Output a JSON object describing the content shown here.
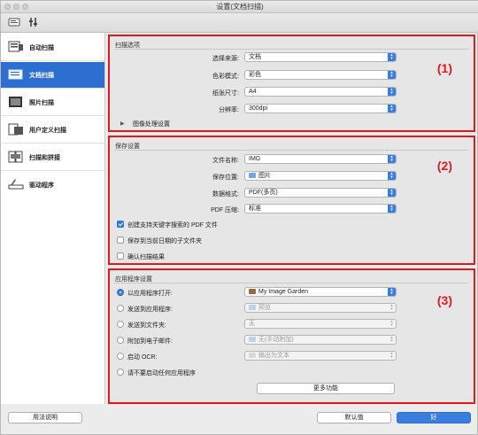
{
  "window": {
    "title": "设置(文档扫描)"
  },
  "toolbar": {
    "tab1_icon": "scanner-settings-icon",
    "tab2_icon": "general-settings-icon"
  },
  "sidebar": {
    "items": [
      {
        "label": "自动扫描",
        "icon": "auto-scan-icon"
      },
      {
        "label": "文档扫描",
        "icon": "document-scan-icon"
      },
      {
        "label": "照片扫描",
        "icon": "photo-scan-icon"
      },
      {
        "label": "用户定义扫描",
        "icon": "custom-scan-icon"
      },
      {
        "label": "扫描和拼接",
        "icon": "scan-stitch-icon"
      },
      {
        "label": "驱动程序",
        "icon": "driver-icon"
      }
    ],
    "selected_index": 1
  },
  "scan_options": {
    "title": "扫描选项",
    "marker": "(1)",
    "rows": [
      {
        "label": "选择来源:",
        "value": "文档"
      },
      {
        "label": "色彩模式:",
        "value": "彩色"
      },
      {
        "label": "纸张尺寸:",
        "value": "A4"
      },
      {
        "label": "分辨率:",
        "value": "300dpi"
      }
    ],
    "image_processing": "图像处理设置"
  },
  "save_settings": {
    "title": "保存设置",
    "marker": "(2)",
    "rows": [
      {
        "label": "文件名称:",
        "value": "IMG"
      },
      {
        "label": "保存位置:",
        "value": "图片"
      },
      {
        "label": "数据格式:",
        "value": "PDF(多页)"
      },
      {
        "label": "PDF 压缩:",
        "value": "标准"
      }
    ],
    "checks": [
      {
        "label": "创建支持关键字搜索的 PDF 文件",
        "checked": true
      },
      {
        "label": "保存到当前日期的子文件夹",
        "checked": false
      },
      {
        "label": "确认扫描结果",
        "checked": false
      }
    ]
  },
  "app_settings": {
    "title": "应用程序设置",
    "marker": "(3)",
    "options": [
      {
        "label": "以应用程序打开:",
        "value": "My Image Garden",
        "selected": true,
        "enabled": true
      },
      {
        "label": "发送到应用程序:",
        "value": "预览",
        "selected": false,
        "enabled": false
      },
      {
        "label": "发送到文件夹:",
        "value": "无",
        "selected": false,
        "enabled": false
      },
      {
        "label": "附加到电子邮件:",
        "value": "无(手动附加)",
        "selected": false,
        "enabled": false
      },
      {
        "label": "启动 OCR:",
        "value": "输出为文本",
        "selected": false,
        "enabled": false
      },
      {
        "label": "请不要启动任何应用程序",
        "value": "",
        "selected": false,
        "enabled": true
      }
    ],
    "more_button": "更多功能"
  },
  "footer": {
    "help_button": "用法说明",
    "defaults_button": "默认值",
    "ok_button": "好"
  },
  "colors": {
    "accent": "#3a7de0",
    "selection": "#2d6ed1",
    "highlight_border": "#e0191f"
  }
}
